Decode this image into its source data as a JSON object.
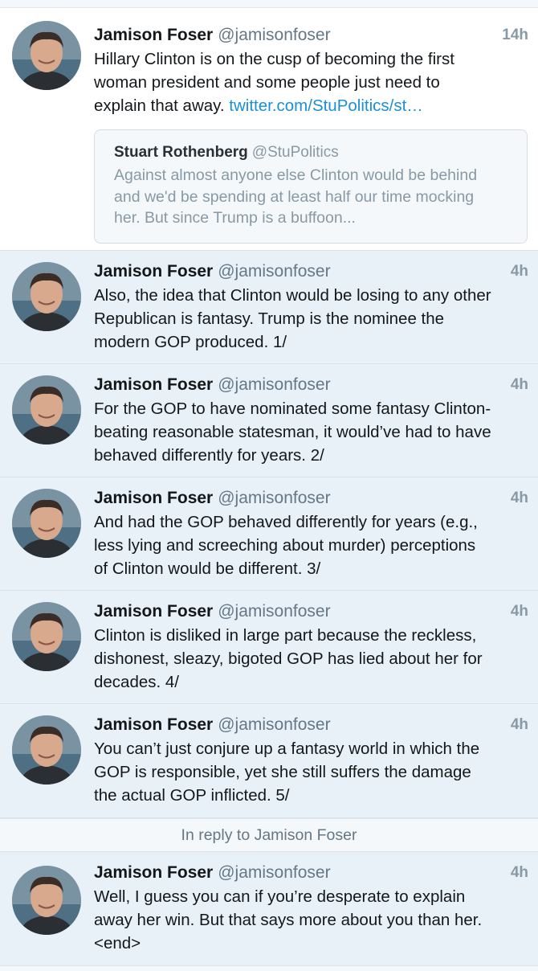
{
  "tweets": [
    {
      "name": "Jamison Foser",
      "handle": "@jamisonfoser",
      "time": "14h",
      "lines": [
        "Hillary Clinton is on the cusp of becoming the first",
        "woman president and some people just need to"
      ],
      "line3_prefix": "explain that away. ",
      "link": "twitter.com/StuPolitics/st…",
      "quote": {
        "name": "Stuart Rothenberg",
        "handle": "@StuPolitics",
        "lines": [
          "Against almost anyone else Clinton would be behind",
          "and we'd be spending at least half our time mocking",
          "her. But since Trump is a buffoon..."
        ]
      }
    },
    {
      "name": "Jamison Foser",
      "handle": "@jamisonfoser",
      "time": "4h",
      "lines": [
        "Also, the idea that Clinton would be losing to any other",
        "Republican is fantasy. Trump is the nominee the",
        "modern GOP produced. 1/"
      ]
    },
    {
      "name": "Jamison Foser",
      "handle": "@jamisonfoser",
      "time": "4h",
      "lines": [
        "For the GOP to have nominated some fantasy Clinton-",
        "beating reasonable statesman, it would’ve had to have",
        "behaved differently for years. 2/"
      ]
    },
    {
      "name": "Jamison Foser",
      "handle": "@jamisonfoser",
      "time": "4h",
      "lines": [
        "And had the GOP behaved differently for years (e.g.,",
        "less lying and screeching about murder) perceptions",
        "of Clinton would be different. 3/"
      ]
    },
    {
      "name": "Jamison Foser",
      "handle": "@jamisonfoser",
      "time": "4h",
      "lines": [
        "Clinton is disliked in large part because the reckless,",
        "dishonest, sleazy, bigoted GOP has lied about her for",
        "decades. 4/"
      ]
    },
    {
      "name": "Jamison Foser",
      "handle": "@jamisonfoser",
      "time": "4h",
      "lines": [
        "You can’t just conjure up a fantasy world in which the",
        "GOP is responsible, yet she still suffers the damage",
        "the actual GOP inflicted. 5/"
      ]
    },
    {
      "name": "Jamison Foser",
      "handle": "@jamisonfoser",
      "time": "4h",
      "lines": [
        "Well, I guess you can if you’re desperate to explain",
        "away her win. But that says more about you than her.",
        "<end>"
      ]
    }
  ],
  "reply_context": "In reply to Jamison Foser",
  "colors": {
    "link": "#1b8fd6",
    "tweet_highlight": "#e8f1f8",
    "muted_text": "#8899a6"
  }
}
